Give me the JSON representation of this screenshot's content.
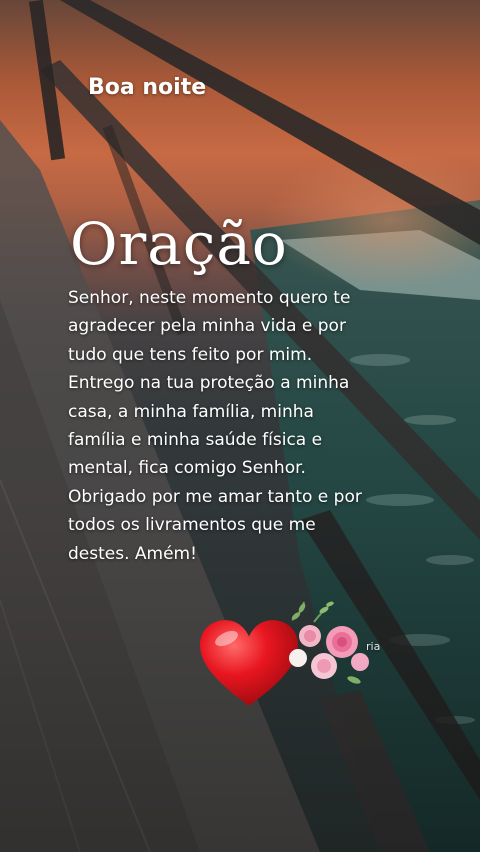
{
  "greeting": "Boa noite",
  "title": "Oração",
  "prayer_lines": [
    "Senhor, neste momento quero te",
    "agradecer pela minha vida e por",
    "tudo que tens feito por mim.",
    "Entrego na tua proteção a minha",
    "casa, a minha família, minha",
    "família e minha saúde física e",
    "mental, fica comigo Senhor.",
    "Obrigado por me amar tanto e por",
    "todos os livramentos que me",
    "destes. Amém!"
  ],
  "watermark": "ria",
  "decorations": {
    "heart_icon": "red-heart-icon",
    "flowers_icon": "pink-roses-icon"
  },
  "colors": {
    "text": "#ffffff",
    "heart": "#e0141e",
    "roses": "#f2a3c0"
  }
}
